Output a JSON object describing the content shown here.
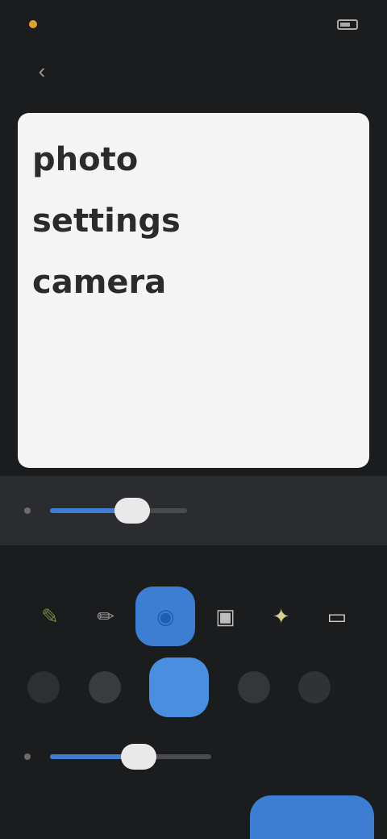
{
  "status_bar": {
    "time": "",
    "battery": ""
  },
  "top_bar": {
    "back_icon": "arrow-left-icon",
    "title": "",
    "action": ""
  },
  "canvas": {
    "lines": [
      "photo",
      "settings",
      "camera"
    ]
  },
  "brush_size": {
    "value": 0.6
  },
  "section": {
    "label": ""
  },
  "tools": [
    {
      "name": "pen",
      "icon": "pen-icon",
      "glyph": "✎",
      "color": "#6c8a3c",
      "selected": false
    },
    {
      "name": "pencil",
      "icon": "pencil-icon",
      "glyph": "✏",
      "color": "#9a9a9a",
      "selected": false
    },
    {
      "name": "marker",
      "icon": "marker-icon",
      "glyph": "◉",
      "color": "#1f5fae",
      "selected": true
    },
    {
      "name": "highlighter",
      "icon": "highlighter-icon",
      "glyph": "▣",
      "color": "#bdbdbd",
      "selected": false
    },
    {
      "name": "brush",
      "icon": "brush-icon",
      "glyph": "✦",
      "color": "#d8d08a",
      "selected": false
    },
    {
      "name": "eraser",
      "icon": "eraser-icon",
      "glyph": "▭",
      "color": "#cfcfcf",
      "selected": false
    }
  ],
  "colors": [
    {
      "name": "black",
      "hex": "#2e2f31"
    },
    {
      "name": "gray",
      "hex": "#3a3b3d"
    },
    {
      "name": "blue",
      "hex": "#4a8fdf",
      "selected": true
    },
    {
      "name": "dark-gray",
      "hex": "#35363a"
    },
    {
      "name": "charcoal",
      "hex": "#313235"
    }
  ],
  "more_colors": {
    "label": ""
  },
  "opacity": {
    "value": 0.55,
    "label": ""
  },
  "bottom_bar": {
    "clear_label": "",
    "done_label": ""
  },
  "accent": "#3c7fd2"
}
